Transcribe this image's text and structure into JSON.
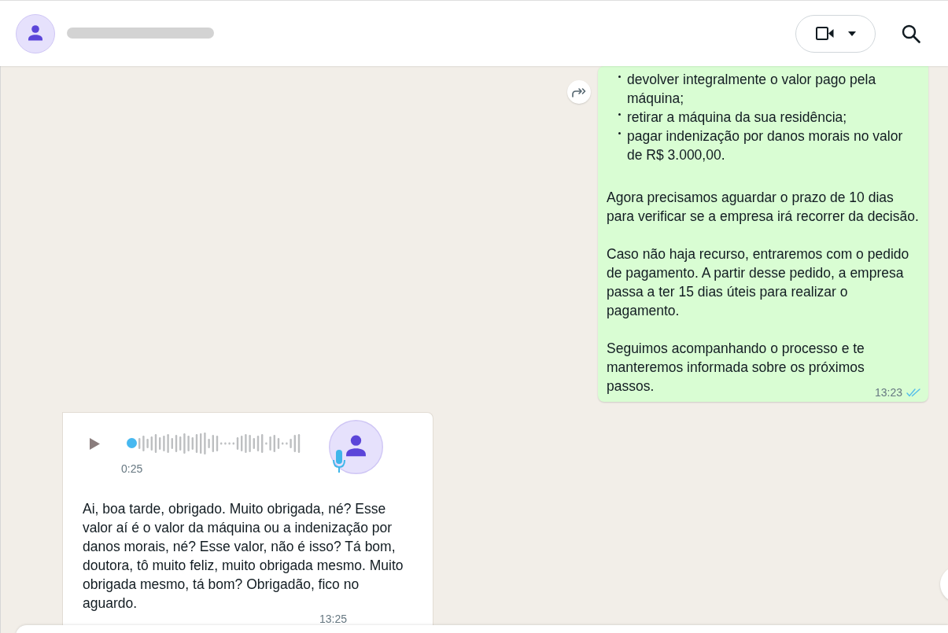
{
  "messages": [
    {
      "kind": "text",
      "from_me": true,
      "forward_button": true,
      "blocks": [
        {
          "kind": "bullets",
          "items": [
            "devolver integralmente o valor pago pela máquina;",
            "retirar a máquina da sua residência;",
            "pagar indenização por danos morais no valor de R$ 3.000,00."
          ]
        },
        {
          "kind": "paragraph",
          "text": "Agora precisamos aguardar o prazo de 10 dias para verificar se a empresa irá recorrer da decisão."
        },
        {
          "kind": "paragraph",
          "text": "Caso não haja recurso, entraremos com o pedido de pagamento. A partir desse pedido, a empresa passa a ter 15 dias úteis para realizar o pagamento."
        },
        {
          "kind": "paragraph",
          "text": "Seguimos acompanhando o processo e te manteremos informada sobre os próximos passos."
        }
      ],
      "time": "13:23",
      "read": true
    },
    {
      "kind": "voice",
      "from_me": false,
      "playing": false,
      "level": 0,
      "duration": "0:25",
      "transcript": "Ai, boa tarde, obrigado. Muito obrigada, né? Esse valor aí é o valor da máquina ou a indenização por danos morais, né? Esse valor, não é isso? Tá bom, doutora, tô muito feliz, muito obrigada mesmo. Muito obrigada mesmo, tá bom? Obrigadão, fico no aguardo.",
      "time": "13:25"
    }
  ]
}
